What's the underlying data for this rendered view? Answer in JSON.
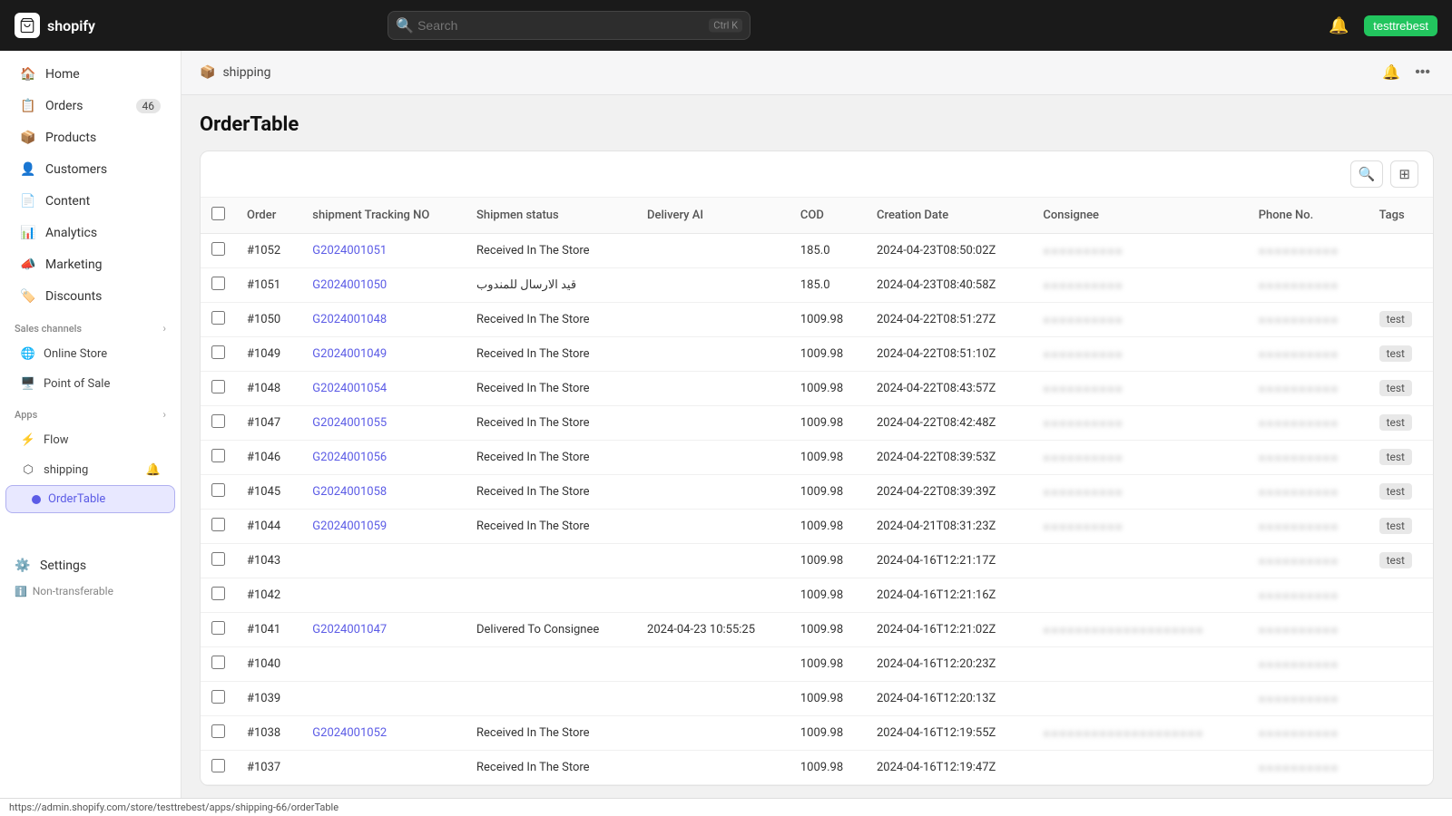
{
  "topNav": {
    "logoText": "shopify",
    "searchPlaceholder": "Search",
    "searchShortcut": "Ctrl K",
    "notifIcon": "🔔",
    "userName": "testtrebest"
  },
  "sidebar": {
    "mainItems": [
      {
        "id": "home",
        "label": "Home",
        "icon": "home",
        "badge": null
      },
      {
        "id": "orders",
        "label": "Orders",
        "icon": "orders",
        "badge": "46"
      },
      {
        "id": "products",
        "label": "Products",
        "icon": "products",
        "badge": null
      },
      {
        "id": "customers",
        "label": "Customers",
        "icon": "customers",
        "badge": null
      },
      {
        "id": "content",
        "label": "Content",
        "icon": "content",
        "badge": null
      },
      {
        "id": "analytics",
        "label": "Analytics",
        "icon": "analytics",
        "badge": null
      },
      {
        "id": "marketing",
        "label": "Marketing",
        "icon": "marketing",
        "badge": null
      },
      {
        "id": "discounts",
        "label": "Discounts",
        "icon": "discounts",
        "badge": null
      }
    ],
    "salesChannelsLabel": "Sales channels",
    "salesChannels": [
      {
        "id": "online-store",
        "label": "Online Store"
      },
      {
        "id": "point-of-sale",
        "label": "Point of Sale"
      }
    ],
    "appsLabel": "Apps",
    "apps": [
      {
        "id": "flow",
        "label": "Flow"
      }
    ],
    "appsSub": {
      "appName": "shipping",
      "notifIcon": "🔔",
      "subItems": [
        {
          "id": "order-table",
          "label": "OrderTable",
          "active": true
        }
      ]
    },
    "settingsLabel": "Settings",
    "nonTransferLabel": "Non-transferable"
  },
  "contentHeader": {
    "icon": "📦",
    "breadcrumb": "shipping",
    "moreIcon": "•••",
    "notifIcon": "🔔"
  },
  "pageTitle": "OrderTable",
  "table": {
    "toolbar": {
      "searchIcon": "🔍",
      "filterIcon": "⊞"
    },
    "columns": [
      "",
      "Order",
      "shipment Tracking NO",
      "Shipmen status",
      "Delivery AI",
      "COD",
      "Creation Date",
      "Consignee",
      "Phone No.",
      "Tags"
    ],
    "rows": [
      {
        "id": "1052",
        "order": "#1052",
        "trackingNo": "G2024001051",
        "status": "Received In The Store",
        "deliveryAI": "",
        "cod": "185.0",
        "creationDate": "2024-04-23T08:50:02Z",
        "consignee": "BLURRED",
        "phone": "BLURRED",
        "tags": ""
      },
      {
        "id": "1051",
        "order": "#1051",
        "trackingNo": "G2024001050",
        "status": "قيد الارسال للمندوب",
        "deliveryAI": "",
        "cod": "185.0",
        "creationDate": "2024-04-23T08:40:58Z",
        "consignee": "BLURRED",
        "phone": "BLURRED",
        "tags": ""
      },
      {
        "id": "1050",
        "order": "#1050",
        "trackingNo": "G2024001048",
        "status": "Received In The Store",
        "deliveryAI": "",
        "cod": "1009.98",
        "creationDate": "2024-04-22T08:51:27Z",
        "consignee": "BLURRED",
        "phone": "BLURRED",
        "tags": "test"
      },
      {
        "id": "1049",
        "order": "#1049",
        "trackingNo": "G2024001049",
        "status": "Received In The Store",
        "deliveryAI": "",
        "cod": "1009.98",
        "creationDate": "2024-04-22T08:51:10Z",
        "consignee": "BLURRED",
        "phone": "BLURRED",
        "tags": "test"
      },
      {
        "id": "1048",
        "order": "#1048",
        "trackingNo": "G2024001054",
        "status": "Received In The Store",
        "deliveryAI": "",
        "cod": "1009.98",
        "creationDate": "2024-04-22T08:43:57Z",
        "consignee": "BLURRED",
        "phone": "BLURRED",
        "tags": "test"
      },
      {
        "id": "1047",
        "order": "#1047",
        "trackingNo": "G2024001055",
        "status": "Received In The Store",
        "deliveryAI": "",
        "cod": "1009.98",
        "creationDate": "2024-04-22T08:42:48Z",
        "consignee": "BLURRED",
        "phone": "BLURRED",
        "tags": "test"
      },
      {
        "id": "1046",
        "order": "#1046",
        "trackingNo": "G2024001056",
        "status": "Received In The Store",
        "deliveryAI": "",
        "cod": "1009.98",
        "creationDate": "2024-04-22T08:39:53Z",
        "consignee": "BLURRED",
        "phone": "BLURRED",
        "tags": "test"
      },
      {
        "id": "1045",
        "order": "#1045",
        "trackingNo": "G2024001058",
        "status": "Received In The Store",
        "deliveryAI": "",
        "cod": "1009.98",
        "creationDate": "2024-04-22T08:39:39Z",
        "consignee": "BLURRED",
        "phone": "BLURRED",
        "tags": "test"
      },
      {
        "id": "1044",
        "order": "#1044",
        "trackingNo": "G2024001059",
        "status": "Received In The Store",
        "deliveryAI": "",
        "cod": "1009.98",
        "creationDate": "2024-04-21T08:31:23Z",
        "consignee": "BLURRED",
        "phone": "BLURRED",
        "tags": "test"
      },
      {
        "id": "1043",
        "order": "#1043",
        "trackingNo": "",
        "status": "",
        "deliveryAI": "",
        "cod": "1009.98",
        "creationDate": "2024-04-16T12:21:17Z",
        "consignee": "",
        "phone": "BLURRED",
        "tags": "test"
      },
      {
        "id": "1042",
        "order": "#1042",
        "trackingNo": "",
        "status": "",
        "deliveryAI": "",
        "cod": "1009.98",
        "creationDate": "2024-04-16T12:21:16Z",
        "consignee": "",
        "phone": "BLURRED",
        "tags": ""
      },
      {
        "id": "1041",
        "order": "#1041",
        "trackingNo": "G2024001047",
        "status": "Delivered To Consignee",
        "deliveryAI": "2024-04-23 10:55:25",
        "cod": "1009.98",
        "creationDate": "2024-04-16T12:21:02Z",
        "consignee": "BLURRED_LONG",
        "phone": "BLURRED",
        "tags": ""
      },
      {
        "id": "1040",
        "order": "#1040",
        "trackingNo": "",
        "status": "",
        "deliveryAI": "",
        "cod": "1009.98",
        "creationDate": "2024-04-16T12:20:23Z",
        "consignee": "",
        "phone": "BLURRED",
        "tags": ""
      },
      {
        "id": "1039",
        "order": "#1039",
        "trackingNo": "",
        "status": "",
        "deliveryAI": "",
        "cod": "1009.98",
        "creationDate": "2024-04-16T12:20:13Z",
        "consignee": "",
        "phone": "BLURRED",
        "tags": ""
      },
      {
        "id": "1038",
        "order": "#1038",
        "trackingNo": "G2024001052",
        "status": "Received In The Store",
        "deliveryAI": "",
        "cod": "1009.98",
        "creationDate": "2024-04-16T12:19:55Z",
        "consignee": "BLURRED_LONG",
        "phone": "BLURRED",
        "tags": ""
      },
      {
        "id": "1037",
        "order": "#1037",
        "trackingNo": "",
        "status": "Received In The Store",
        "deliveryAI": "",
        "cod": "1009.98",
        "creationDate": "2024-04-16T12:19:47Z",
        "consignee": "",
        "phone": "BLURRED",
        "tags": ""
      }
    ]
  },
  "statusBarUrl": "https://admin.shopify.com/store/testtrebest/apps/shipping-66/orderTable"
}
